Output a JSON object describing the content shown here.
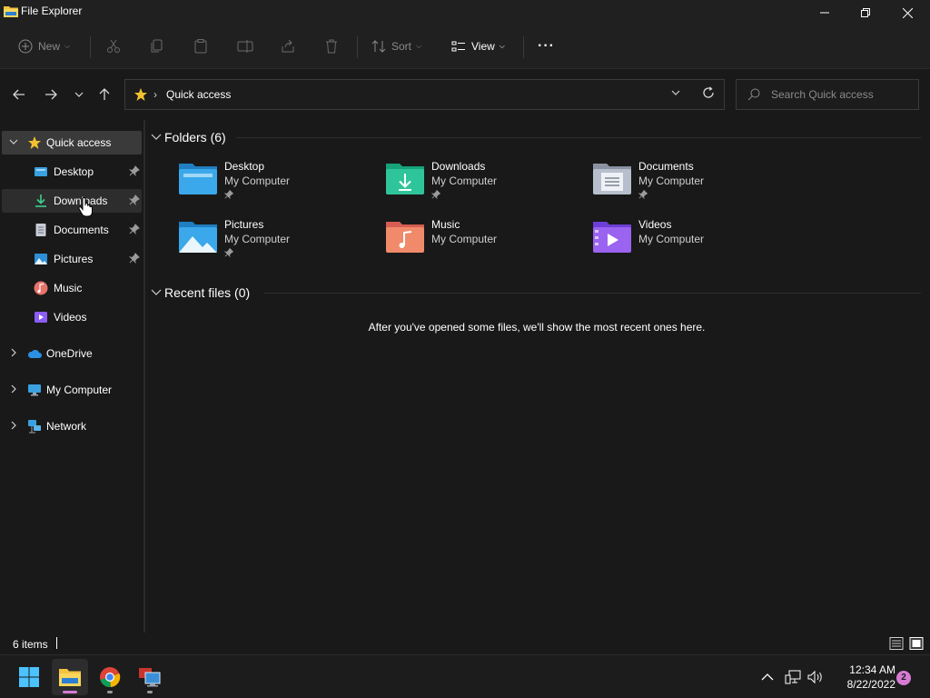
{
  "window": {
    "title": "File Explorer"
  },
  "ribbon": {
    "new_label": "New",
    "sort_label": "Sort",
    "view_label": "View",
    "more_label": "···"
  },
  "address": {
    "location": "Quick access"
  },
  "search": {
    "placeholder": "Search Quick access"
  },
  "sidebar": {
    "items": [
      {
        "label": "Quick access",
        "icon": "star-icon",
        "selected": true
      },
      {
        "label": "Desktop",
        "icon": "desktop-folder-icon",
        "pinned": true
      },
      {
        "label": "Downloads",
        "icon": "downloads-icon",
        "pinned": true
      },
      {
        "label": "Documents",
        "icon": "documents-icon",
        "pinned": true
      },
      {
        "label": "Pictures",
        "icon": "pictures-icon",
        "pinned": true
      },
      {
        "label": "Music",
        "icon": "music-icon"
      },
      {
        "label": "Videos",
        "icon": "videos-icon"
      },
      {
        "label": "OneDrive",
        "icon": "onedrive-icon"
      },
      {
        "label": "My Computer",
        "icon": "computer-icon"
      },
      {
        "label": "Network",
        "icon": "network-icon"
      }
    ]
  },
  "content": {
    "folders_heading": "Folders (6)",
    "recent_heading": "Recent files (0)",
    "empty_message": "After you've opened some files, we'll show the most recent ones here.",
    "folders": [
      {
        "name": "Desktop",
        "location": "My Computer",
        "pinned": true
      },
      {
        "name": "Downloads",
        "location": "My Computer",
        "pinned": true
      },
      {
        "name": "Documents",
        "location": "My Computer",
        "pinned": true
      },
      {
        "name": "Pictures",
        "location": "My Computer",
        "pinned": true
      },
      {
        "name": "Music",
        "location": "My Computer",
        "pinned": false
      },
      {
        "name": "Videos",
        "location": "My Computer",
        "pinned": false
      }
    ]
  },
  "status": {
    "item_count": "6 items"
  },
  "taskbar": {
    "time": "12:34 AM",
    "date": "8/22/2022",
    "notification_count": "2"
  },
  "colors": {
    "background": "#191919",
    "chrome": "#202020",
    "selected": "#3a3a3a",
    "accent_star": "#f2c12e",
    "folder_blue": "#3aa0e0"
  }
}
